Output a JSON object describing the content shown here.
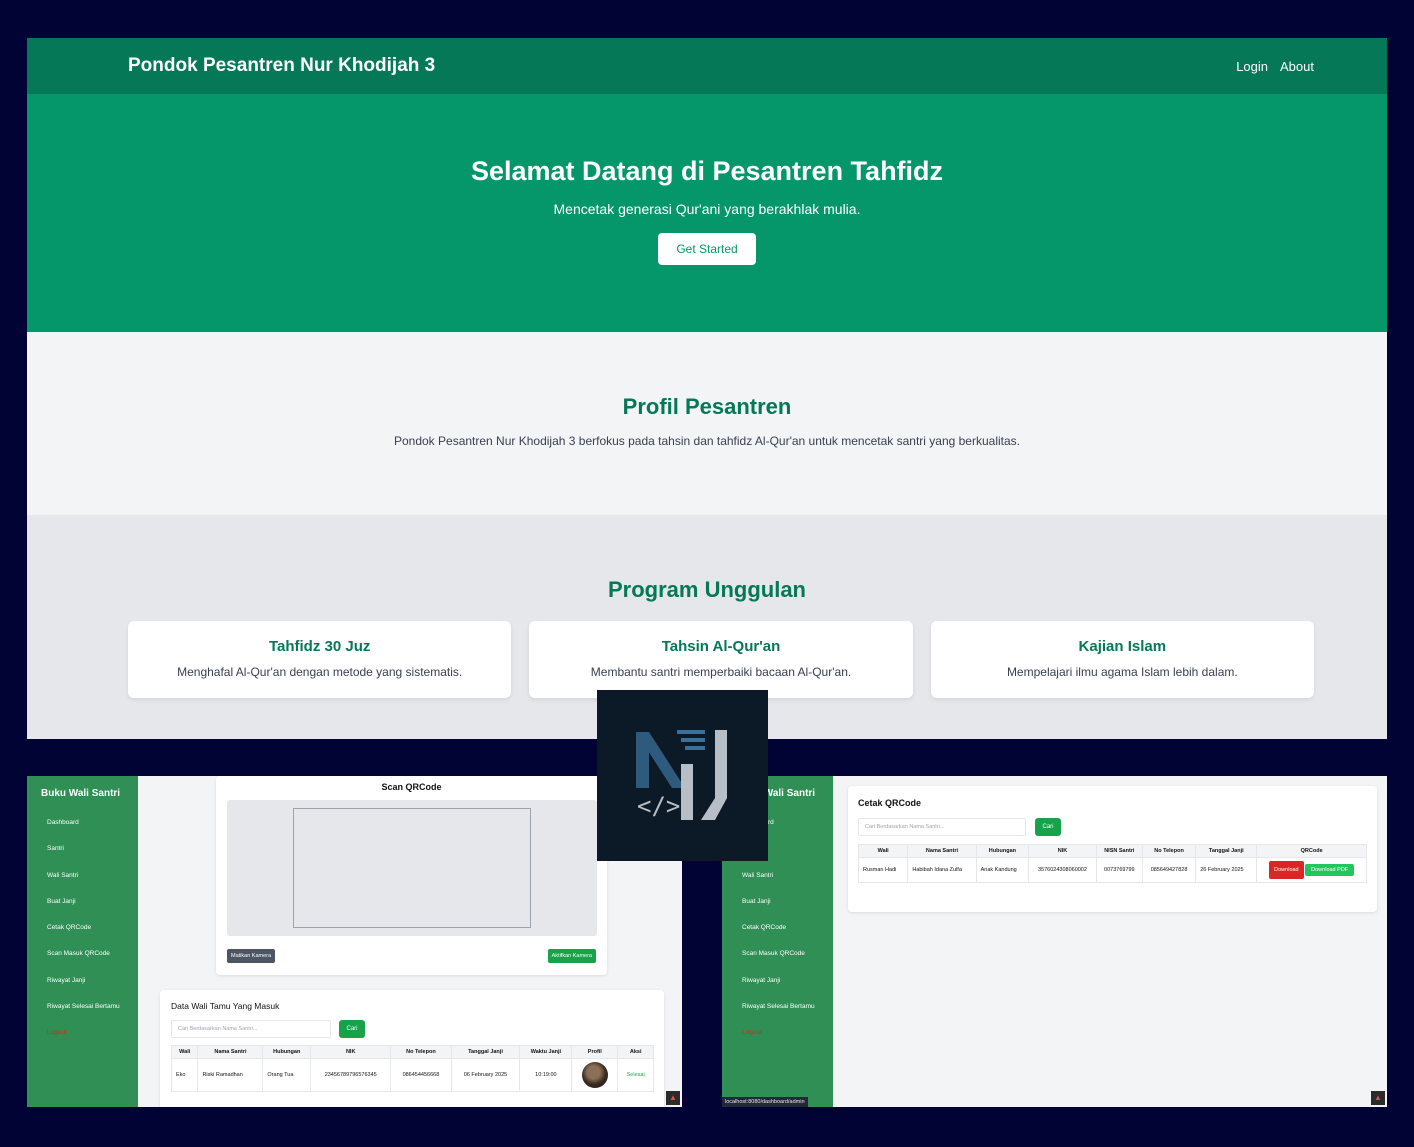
{
  "landing": {
    "brand": "Pondok Pesantren Nur Khodijah 3",
    "nav": [
      "Login",
      "About"
    ],
    "hero": {
      "title": "Selamat Datang di Pesantren Tahfidz",
      "subtitle": "Mencetak generasi Qur'ani yang berakhlak mulia.",
      "cta": "Get Started"
    },
    "profil": {
      "title": "Profil Pesantren",
      "text": "Pondok Pesantren Nur Khodijah 3 berfokus pada tahsin dan tahfidz Al-Qur'an untuk mencetak santri yang berkualitas."
    },
    "program": {
      "title": "Program Unggulan",
      "cards": [
        {
          "title": "Tahfidz 30 Juz",
          "text": "Menghafal Al-Qur'an dengan metode yang sistematis."
        },
        {
          "title": "Tahsin Al-Qur'an",
          "text": "Membantu santri memperbaiki bacaan Al-Qur'an."
        },
        {
          "title": "Kajian Islam",
          "text": "Mempelajari ilmu agama Islam lebih dalam."
        }
      ]
    }
  },
  "sidebar": {
    "title": "Buku Wali Santri",
    "items": [
      "Dashboard",
      "Santri",
      "Wali Santri",
      "Buat Janji",
      "Cetak QRCode",
      "Scan Masuk QRCode",
      "Riwayat Janji",
      "Riwayat Selesai Bertamu",
      "Logout"
    ]
  },
  "scan": {
    "title": "Scan QRCode",
    "btn_off": "Matikan Kamera",
    "btn_on": "Aktifkan Kamera"
  },
  "wali_table": {
    "title": "Data Wali Tamu Yang Masuk",
    "search_placeholder": "Cari Berdasarkan Nama Santri...",
    "search_btn": "Cari",
    "headers": [
      "Wali",
      "Nama Santri",
      "Hubungan",
      "NIK",
      "No Telepon",
      "Tanggal Janji",
      "Waktu Janji",
      "Profil",
      "Aksi"
    ],
    "row": {
      "wali": "Eko",
      "santri": "Riski Ramadhan",
      "hubungan": "Orang Tua",
      "nik": "23456789796576345",
      "telepon": "086454456668",
      "tanggal": "06 February 2025",
      "waktu": "10:19:00",
      "aksi": "Selesai"
    }
  },
  "cetak": {
    "title": "Cetak QRCode",
    "search_placeholder": "Cari Berdasarkan Nama Santri...",
    "search_btn": "Cari",
    "headers": [
      "Wali",
      "Nama Santri",
      "Hubungan",
      "NIK",
      "NISN Santri",
      "No Telepon",
      "Tanggal Janji",
      "QRCode"
    ],
    "row": {
      "wali": "Rusman Hadi",
      "santri": "Habibah Idana Zulfa",
      "hubungan": "Anak Kandung",
      "nik": "3576024308060002",
      "nisn": "0073769799",
      "telepon": "085649427828",
      "tanggal": "26 February 2025",
      "download": "Download",
      "download_pdf": "Download PDF"
    }
  },
  "status_url": "localhost:8080/dashboard/admin"
}
